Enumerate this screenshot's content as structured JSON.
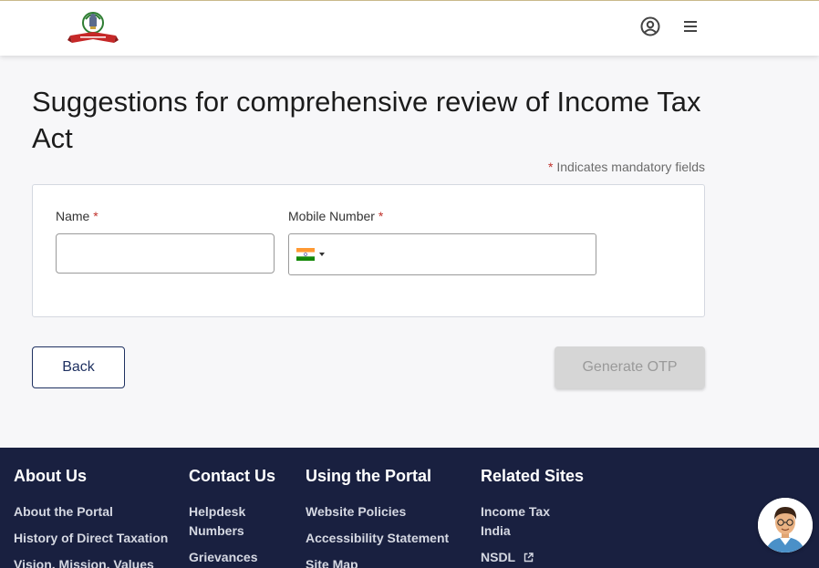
{
  "header": {
    "logo_alt": "Income Tax Department logo",
    "user_icon": "user-circle-icon",
    "menu_icon": "hamburger-menu-icon"
  },
  "page": {
    "title": "Suggestions for comprehensive review of Income Tax Act",
    "mandatory_note": "Indicates mandatory fields",
    "required_mark": "*"
  },
  "form": {
    "name_label": "Name",
    "name_value": "",
    "mobile_label": "Mobile Number",
    "mobile_value": "",
    "country_flag": "india-flag-icon"
  },
  "actions": {
    "back_label": "Back",
    "generate_otp_label": "Generate OTP"
  },
  "footer": {
    "about": {
      "heading": "About Us",
      "links": [
        "About the Portal",
        "History of Direct Taxation",
        "Vision, Mission, Values"
      ]
    },
    "contact": {
      "heading": "Contact Us",
      "links": [
        "Helpdesk",
        "Numbers",
        "Grievances"
      ]
    },
    "portal": {
      "heading": "Using the Portal",
      "links": [
        "Website Policies",
        "Accessibility Statement",
        "Site Map"
      ]
    },
    "related": {
      "heading": "Related Sites",
      "links": [
        "Income Tax",
        "India",
        "NSDL"
      ]
    }
  },
  "colors": {
    "brand_navy": "#192040",
    "button_navy": "#1f3161",
    "required_red": "#c0312b",
    "disabled_gray": "#d6d6d6"
  }
}
